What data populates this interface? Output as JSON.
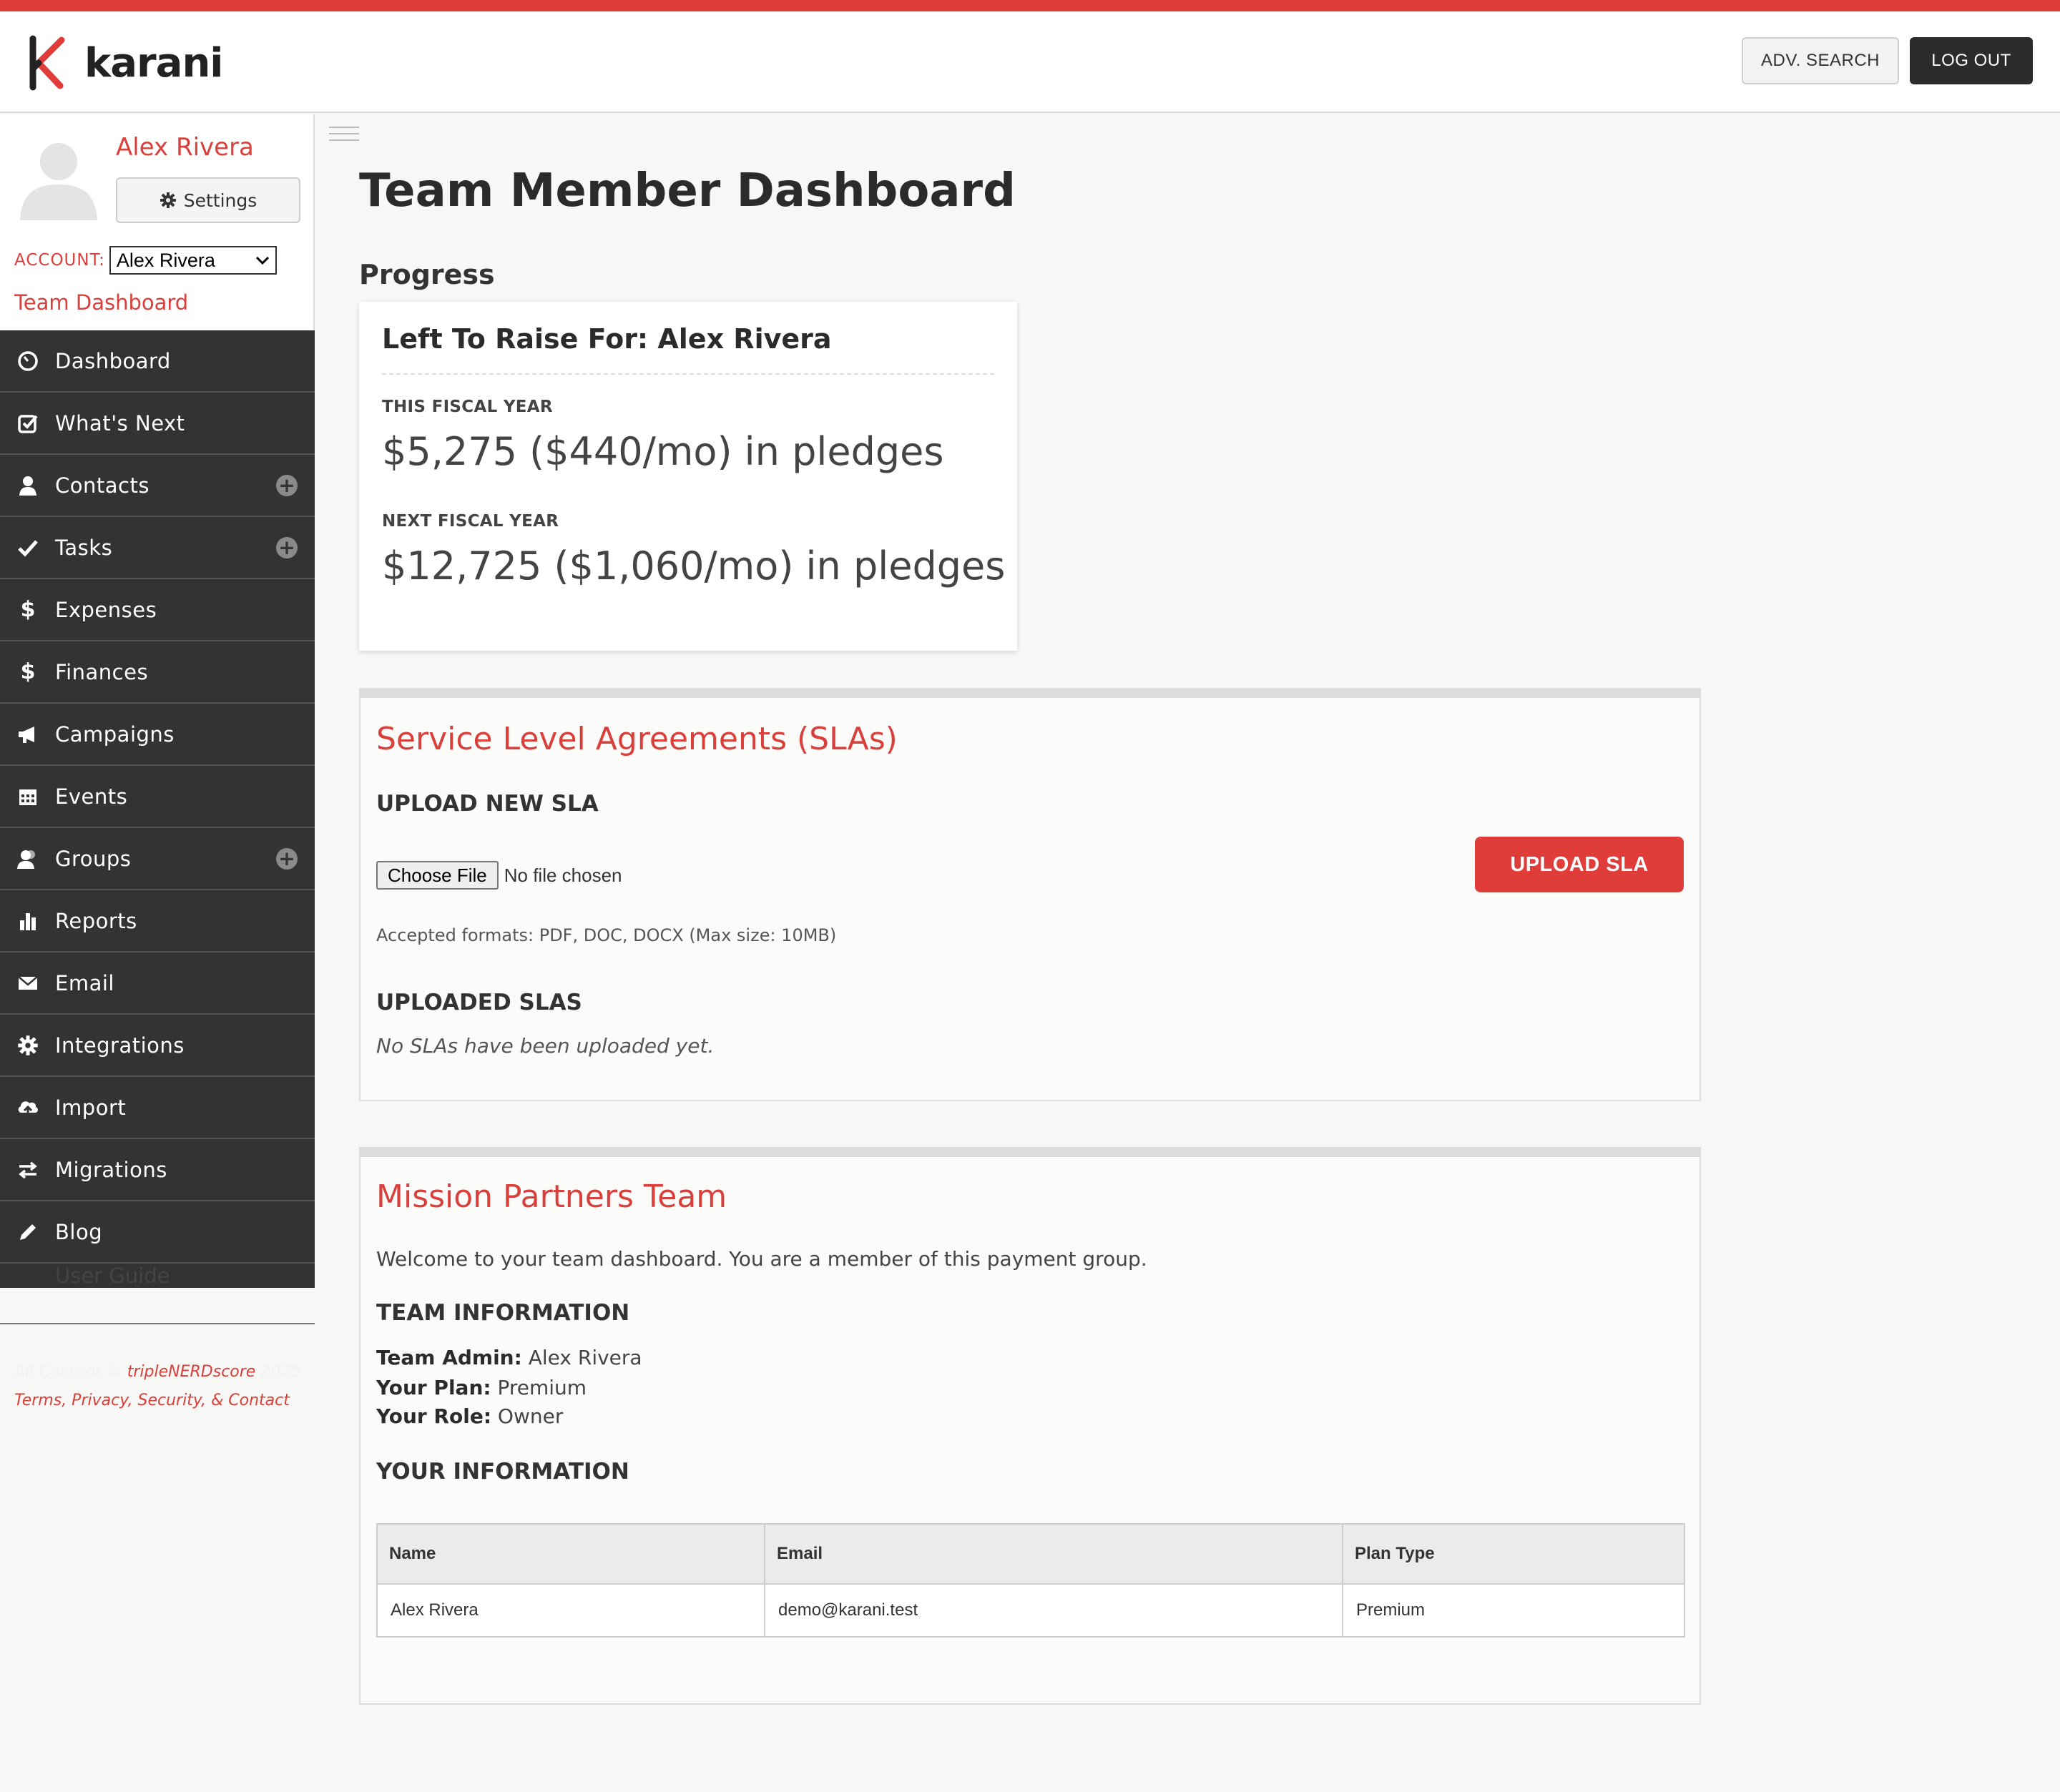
{
  "header": {
    "logo_text": "karani",
    "adv_search_label": "ADV. SEARCH",
    "logout_label": "LOG OUT",
    "accent_color": "#e03c3a"
  },
  "profile": {
    "user_name": "Alex Rivera",
    "settings_label": "Settings",
    "account_label": "ACCOUNT:",
    "account_selected": "Alex Rivera",
    "team_dashboard_link": "Team Dashboard"
  },
  "nav": {
    "items": [
      {
        "label": "Dashboard",
        "icon": "dashboard-icon",
        "has_add": false
      },
      {
        "label": "What's Next",
        "icon": "check-square-icon",
        "has_add": false
      },
      {
        "label": "Contacts",
        "icon": "user-icon",
        "has_add": true
      },
      {
        "label": "Tasks",
        "icon": "checkmark-icon",
        "has_add": true
      },
      {
        "label": "Expenses",
        "icon": "dollar-icon",
        "has_add": false
      },
      {
        "label": "Finances",
        "icon": "dollar-icon",
        "has_add": false
      },
      {
        "label": "Campaigns",
        "icon": "megaphone-icon",
        "has_add": false
      },
      {
        "label": "Events",
        "icon": "calendar-icon",
        "has_add": false
      },
      {
        "label": "Groups",
        "icon": "users-icon",
        "has_add": true
      },
      {
        "label": "Reports",
        "icon": "bar-chart-icon",
        "has_add": false
      },
      {
        "label": "Email",
        "icon": "envelope-icon",
        "has_add": false
      },
      {
        "label": "Integrations",
        "icon": "gear-icon",
        "has_add": false
      },
      {
        "label": "Import",
        "icon": "cloud-upload-icon",
        "has_add": false
      },
      {
        "label": "Migrations",
        "icon": "exchange-icon",
        "has_add": false
      },
      {
        "label": "Blog",
        "icon": "pencil-icon",
        "has_add": false
      }
    ],
    "partial_item_label": "User Guide"
  },
  "footer": {
    "line1_prefix": "All Content ©",
    "line1_brand": "tripleNERDscore",
    "line1_suffix": "2025",
    "line2": "Terms, Privacy, Security, & Contact"
  },
  "main": {
    "page_title": "Team Member Dashboard",
    "progress_heading": "Progress",
    "progress_card": {
      "title": "Left To Raise For: Alex Rivera",
      "this_year_label": "THIS FISCAL YEAR",
      "this_year_value": "$5,275 ($440/mo) in pledges",
      "next_year_label": "NEXT FISCAL YEAR",
      "next_year_value": "$12,725 ($1,060/mo) in pledges"
    },
    "sla": {
      "title": "Service Level Agreements (SLAs)",
      "upload_heading": "UPLOAD NEW SLA",
      "choose_file_label": "Choose File",
      "no_file_text": "No file chosen",
      "upload_button": "UPLOAD SLA",
      "accepted_formats": "Accepted formats: PDF, DOC, DOCX (Max size: 10MB)",
      "uploaded_heading": "UPLOADED SLAS",
      "empty_text": "No SLAs have been uploaded yet."
    },
    "team": {
      "title": "Mission Partners Team",
      "welcome": "Welcome to your team dashboard. You are a member of this payment group.",
      "team_info_heading": "TEAM INFORMATION",
      "team_admin_label": "Team Admin:",
      "team_admin_value": "Alex Rivera",
      "plan_label": "Your Plan:",
      "plan_value": "Premium",
      "role_label": "Your Role:",
      "role_value": "Owner",
      "your_info_heading": "YOUR INFORMATION",
      "table": {
        "headers": [
          "Name",
          "Email",
          "Plan Type"
        ],
        "rows": [
          [
            "Alex Rivera",
            "demo@karani.test",
            "Premium"
          ]
        ]
      }
    }
  }
}
